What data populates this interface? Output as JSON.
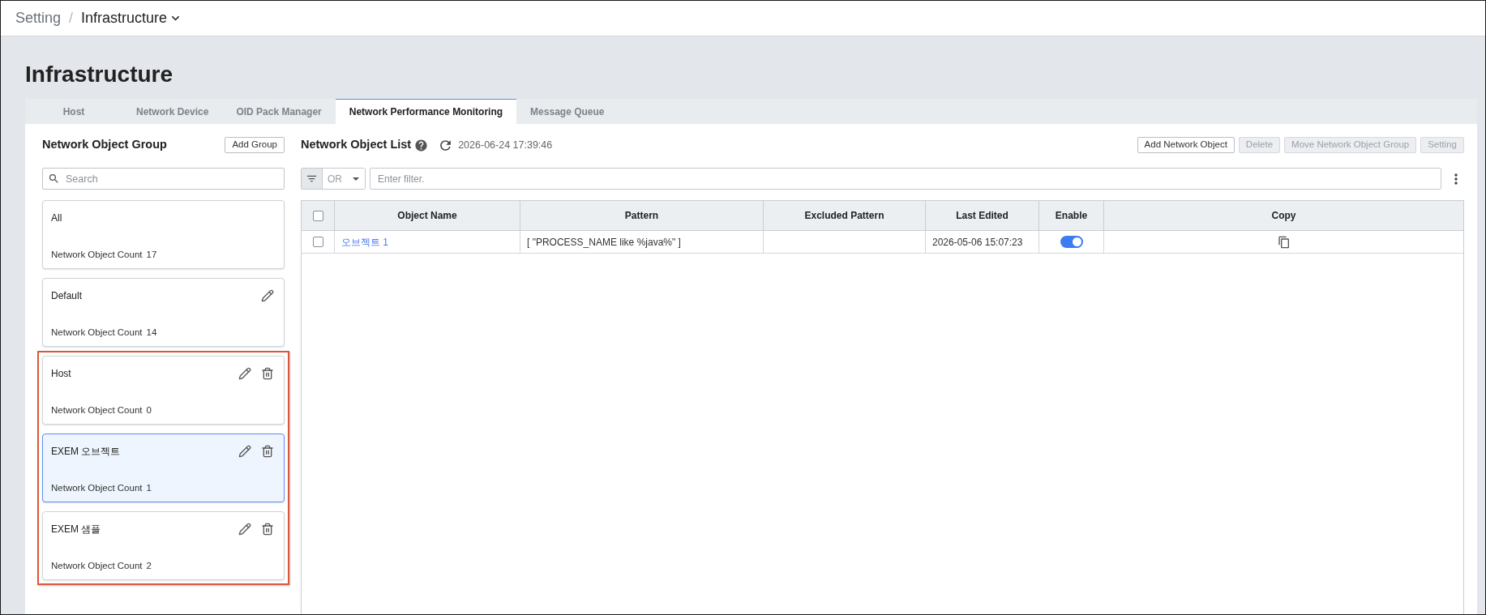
{
  "breadcrumb": {
    "parent": "Setting",
    "separator": "/",
    "current": "Infrastructure"
  },
  "page_title": "Infrastructure",
  "tabs": [
    {
      "label": "Host",
      "selected": false
    },
    {
      "label": "Network Device",
      "selected": false
    },
    {
      "label": "OID Pack Manager",
      "selected": false
    },
    {
      "label": "Network Performance Monitoring",
      "selected": true
    },
    {
      "label": "Message Queue",
      "selected": false
    }
  ],
  "group_panel": {
    "title": "Network Object Group",
    "add_button": "Add Group",
    "search": {
      "placeholder": "Search"
    },
    "groups": [
      {
        "name": "All",
        "count_label": "Network Object Count",
        "count": "17",
        "editable": false,
        "deletable": false,
        "selected": false,
        "highlighted": false
      },
      {
        "name": "Default",
        "count_label": "Network Object Count",
        "count": "14",
        "editable": true,
        "deletable": false,
        "selected": false,
        "highlighted": false
      },
      {
        "name": "Host",
        "count_label": "Network Object Count",
        "count": "0",
        "editable": true,
        "deletable": true,
        "selected": false,
        "highlighted": true
      },
      {
        "name": "EXEM 오브젝트",
        "count_label": "Network Object Count",
        "count": "1",
        "editable": true,
        "deletable": true,
        "selected": true,
        "highlighted": true
      },
      {
        "name": "EXEM 샘플",
        "count_label": "Network Object Count",
        "count": "2",
        "editable": true,
        "deletable": true,
        "selected": false,
        "highlighted": true
      }
    ]
  },
  "list_panel": {
    "title": "Network Object List",
    "timestamp": "2026-06-24 17:39:46",
    "buttons": [
      {
        "label": "Add Network Object",
        "disabled": false
      },
      {
        "label": "Delete",
        "disabled": true
      },
      {
        "label": "Move Network Object Group",
        "disabled": true
      },
      {
        "label": "Setting",
        "disabled": true
      }
    ],
    "filter": {
      "operator": "OR",
      "placeholder": "Enter filter."
    },
    "table": {
      "select_all": {
        "checked": false
      },
      "columns": [
        "Object Name",
        "Pattern",
        "Excluded Pattern",
        "Last Edited",
        "Enable",
        "Copy"
      ],
      "rows": [
        {
          "checked": false,
          "object_name": "오브젝트 1",
          "pattern": "[ \"PROCESS_NAME like %java%\" ]",
          "last_edited": "2026-05-06 15:07:23",
          "enabled": true
        }
      ]
    }
  }
}
